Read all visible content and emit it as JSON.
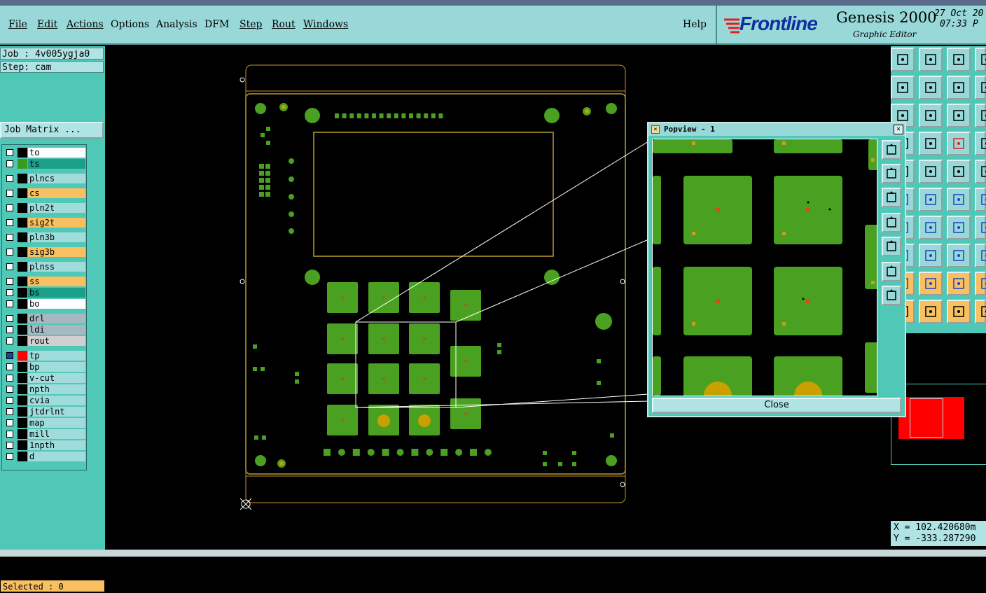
{
  "menu": {
    "items": [
      {
        "label": "File"
      },
      {
        "label": "Edit"
      },
      {
        "label": "Actions"
      },
      {
        "label": "Options"
      },
      {
        "label": "Analysis"
      },
      {
        "label": "DFM"
      },
      {
        "label": "Step"
      },
      {
        "label": "Rout"
      },
      {
        "label": "Windows"
      }
    ],
    "help": "Help"
  },
  "brand": {
    "logo": "Frontline",
    "product": "Genesis 2000",
    "subtitle": "Graphic Editor",
    "date": "27 Oct 20",
    "time": "07:33 P"
  },
  "job": {
    "job_line": "Job : 4v005ygja0",
    "step_line": "Step: cam",
    "matrix_button": "Job Matrix ..."
  },
  "layers": [
    {
      "name": "to",
      "bg": "#ffffff",
      "swatch": "#000000"
    },
    {
      "name": "ts",
      "bg": "#1aa088",
      "swatch": "#3a9a20"
    },
    {
      "name": "plncs",
      "bg": "#a0dcdc",
      "swatch": "#000000"
    },
    {
      "name": "cs",
      "bg": "#f8c060",
      "swatch": "#000000"
    },
    {
      "name": "pln2t",
      "bg": "#a0dcdc",
      "swatch": "#000000"
    },
    {
      "name": "sig2t",
      "bg": "#f8c060",
      "swatch": "#000000"
    },
    {
      "name": "pln3b",
      "bg": "#a0dcdc",
      "swatch": "#000000"
    },
    {
      "name": "sig3b",
      "bg": "#f8c060",
      "swatch": "#000000"
    },
    {
      "name": "plnss",
      "bg": "#a0dcdc",
      "swatch": "#000000"
    },
    {
      "name": "ss",
      "bg": "#f8c060",
      "swatch": "#000000"
    },
    {
      "name": "bs",
      "bg": "#1aa088",
      "swatch": "#000000"
    },
    {
      "name": "bo",
      "bg": "#ffffff",
      "swatch": "#000000"
    },
    {
      "name": "drl",
      "bg": "#a8b8c0",
      "swatch": "#000000"
    },
    {
      "name": "ldi",
      "bg": "#a8b8c0",
      "swatch": "#000000"
    },
    {
      "name": "rout",
      "bg": "#d0d0d0",
      "swatch": "#000000"
    },
    {
      "name": "tp",
      "bg": "#a0dcdc",
      "swatch": "#ff0000"
    },
    {
      "name": "bp",
      "bg": "#a0dcdc",
      "swatch": "#000000"
    },
    {
      "name": "v-cut",
      "bg": "#a0dcdc",
      "swatch": "#000000"
    },
    {
      "name": "npth",
      "bg": "#a0dcdc",
      "swatch": "#000000"
    },
    {
      "name": "cvia",
      "bg": "#a0dcdc",
      "swatch": "#000000"
    },
    {
      "name": "jtdrlnt",
      "bg": "#a0dcdc",
      "swatch": "#000000"
    },
    {
      "name": "map",
      "bg": "#a0dcdc",
      "swatch": "#000000"
    },
    {
      "name": "mill",
      "bg": "#a0dcdc",
      "swatch": "#000000"
    },
    {
      "name": "1npth",
      "bg": "#a0dcdc",
      "swatch": "#000000"
    },
    {
      "name": "d",
      "bg": "#a0dcdc",
      "swatch": "#000000"
    }
  ],
  "status": {
    "selected": "Selected : 0"
  },
  "coords": {
    "x": "X = 102.420680m",
    "y": "Y = -333.287290"
  },
  "popup": {
    "title": "Popview - 1",
    "close_label": "Close"
  },
  "colors": {
    "pad": "#4aa020",
    "board_outline": "#b8a030",
    "gold": "#c8a000",
    "rout_outline": "#c89030",
    "accent": "#e02020"
  }
}
